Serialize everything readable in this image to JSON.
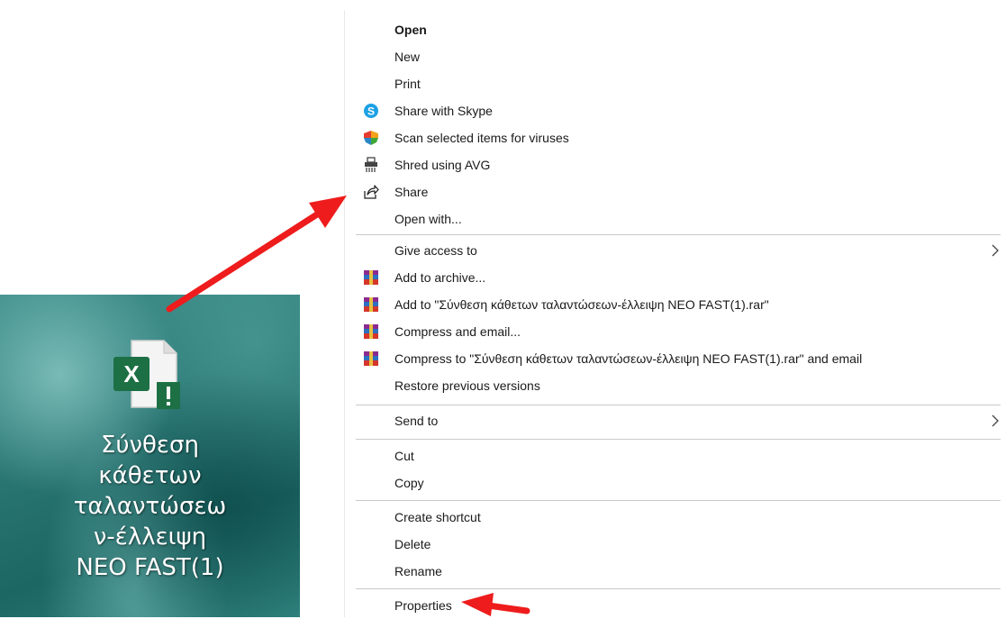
{
  "desktop": {
    "file_label_lines": [
      "Σύνθεση",
      "κάθετων",
      "ταλαντώσεω",
      "ν-έλλειψη",
      "NEO FAST(1)"
    ],
    "file_icon": "excel-file-warning-icon",
    "excel_badge_letter": "X"
  },
  "menu": {
    "items": [
      {
        "label": "Open",
        "bold": true
      },
      {
        "label": "New"
      },
      {
        "label": "Print"
      },
      {
        "label": "Share with Skype",
        "icon": "skype-icon"
      },
      {
        "label": "Scan selected items for viruses",
        "icon": "avg-scan-icon"
      },
      {
        "label": "Shred using AVG",
        "icon": "shredder-icon"
      },
      {
        "label": "Share",
        "icon": "share-icon"
      },
      {
        "label": "Open with..."
      },
      {
        "label": "Give access to",
        "submenu": true
      },
      {
        "label": "Add to archive...",
        "icon": "winrar-icon"
      },
      {
        "label": "Add to \"Σύνθεση κάθετων ταλαντώσεων-έλλειψη NEO FAST(1).rar\"",
        "icon": "winrar-icon"
      },
      {
        "label": "Compress and email...",
        "icon": "winrar-icon"
      },
      {
        "label": "Compress to \"Σύνθεση κάθετων ταλαντώσεων-έλλειψη NEO FAST(1).rar\" and email",
        "icon": "winrar-icon"
      },
      {
        "label": "Restore previous versions"
      },
      {
        "label": "Send to",
        "submenu": true
      },
      {
        "label": "Cut"
      },
      {
        "label": "Copy"
      },
      {
        "label": "Create shortcut"
      },
      {
        "label": "Delete"
      },
      {
        "label": "Rename"
      },
      {
        "label": "Properties"
      }
    ]
  },
  "colors": {
    "annotation_arrow": "#ee1c1c",
    "excel_green": "#1d7044",
    "skype_blue": "#1da1e5",
    "separator": "#c9c9c9"
  }
}
